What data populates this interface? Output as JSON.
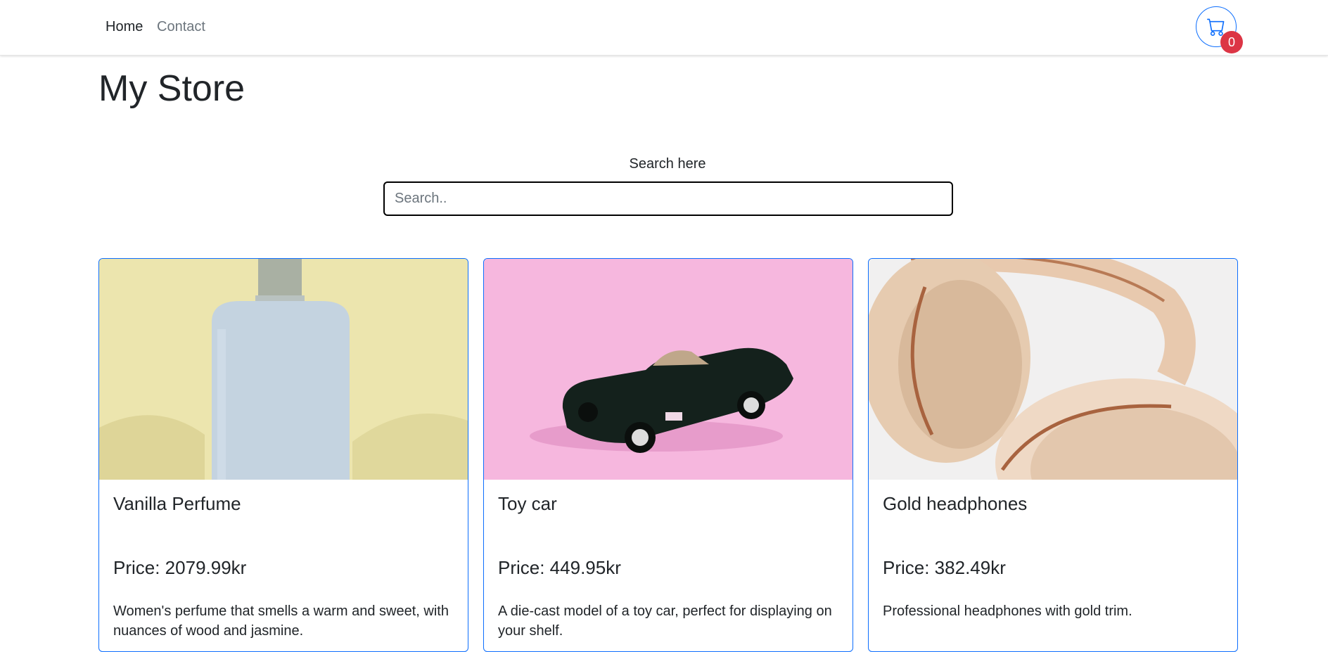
{
  "nav": {
    "home": "Home",
    "contact": "Contact",
    "cart_icon": "shopping-cart-icon",
    "cart_count": "0",
    "accent": "#0d6efd",
    "badge_color": "#dc3545"
  },
  "store": {
    "title": "My Store"
  },
  "search": {
    "label": "Search here",
    "placeholder": "Search..",
    "value": ""
  },
  "products": [
    {
      "title": "Vanilla Perfume",
      "price": "Price: 2079.99kr",
      "description": "Women's perfume that smells a warm and sweet, with nuances of wood and jasmine.",
      "image": "perfume-bottle-image"
    },
    {
      "title": "Toy car",
      "price": "Price: 449.95kr",
      "description": "A die-cast model of a toy car, perfect for displaying on your shelf.",
      "image": "toy-car-image"
    },
    {
      "title": "Gold headphones",
      "price": "Price: 382.49kr",
      "description": "Professional headphones with gold trim.",
      "image": "headphones-image"
    }
  ]
}
